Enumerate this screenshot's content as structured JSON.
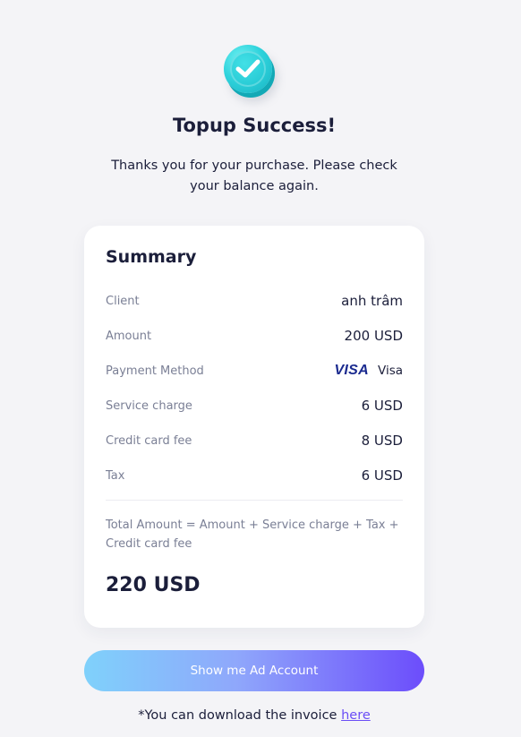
{
  "header": {
    "title": "Topup Success!",
    "subtitle_line1": "Thanks you for your purchase. Please check",
    "subtitle_line2": "your balance again."
  },
  "summary": {
    "title": "Summary",
    "rows": [
      {
        "label": "Client",
        "value": "anh trâm"
      },
      {
        "label": "Amount",
        "value": "200 USD"
      },
      {
        "label": "Payment Method",
        "logo": "VISA",
        "value": "Visa"
      },
      {
        "label": "Service charge",
        "value": "6 USD"
      },
      {
        "label": "Credit card fee",
        "value": "8 USD"
      },
      {
        "label": "Tax",
        "value": "6 USD"
      }
    ],
    "formula_line1": "Total Amount = Amount + Service charge + Tax +",
    "formula_line2": "Credit card fee",
    "total": "220 USD"
  },
  "cta": {
    "label": "Show me Ad Account"
  },
  "footer": {
    "text": "*You can download the invoice",
    "link_label": "here"
  },
  "icons": {
    "success": "check-circle-icon"
  }
}
